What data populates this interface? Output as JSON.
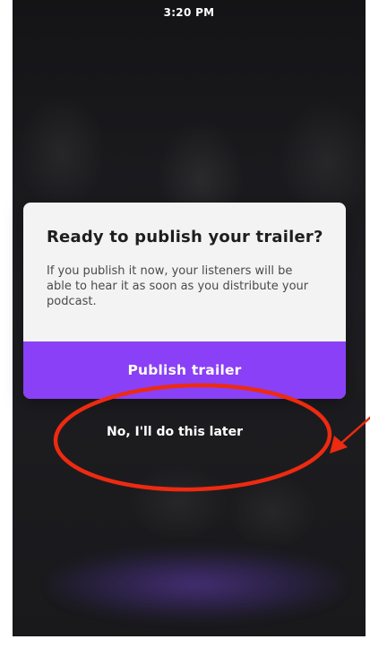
{
  "status_bar": {
    "time": "3:20 PM"
  },
  "dialog": {
    "title": "Ready to publish your trailer?",
    "body": "If you publish it now, your listeners will be able to hear it as soon as you distribute your podcast.",
    "primary_button_label": "Publish trailer"
  },
  "secondary_action": {
    "label": "No, I'll do this later"
  },
  "colors": {
    "accent_purple": "#8a40f6",
    "annotation_red": "#ee2a10",
    "dialog_background": "#f3f3f3",
    "overlay_background": "#1c1c1f"
  },
  "annotations": {
    "highlight_shape": "red-ellipse",
    "pointer": "red-arrow"
  }
}
